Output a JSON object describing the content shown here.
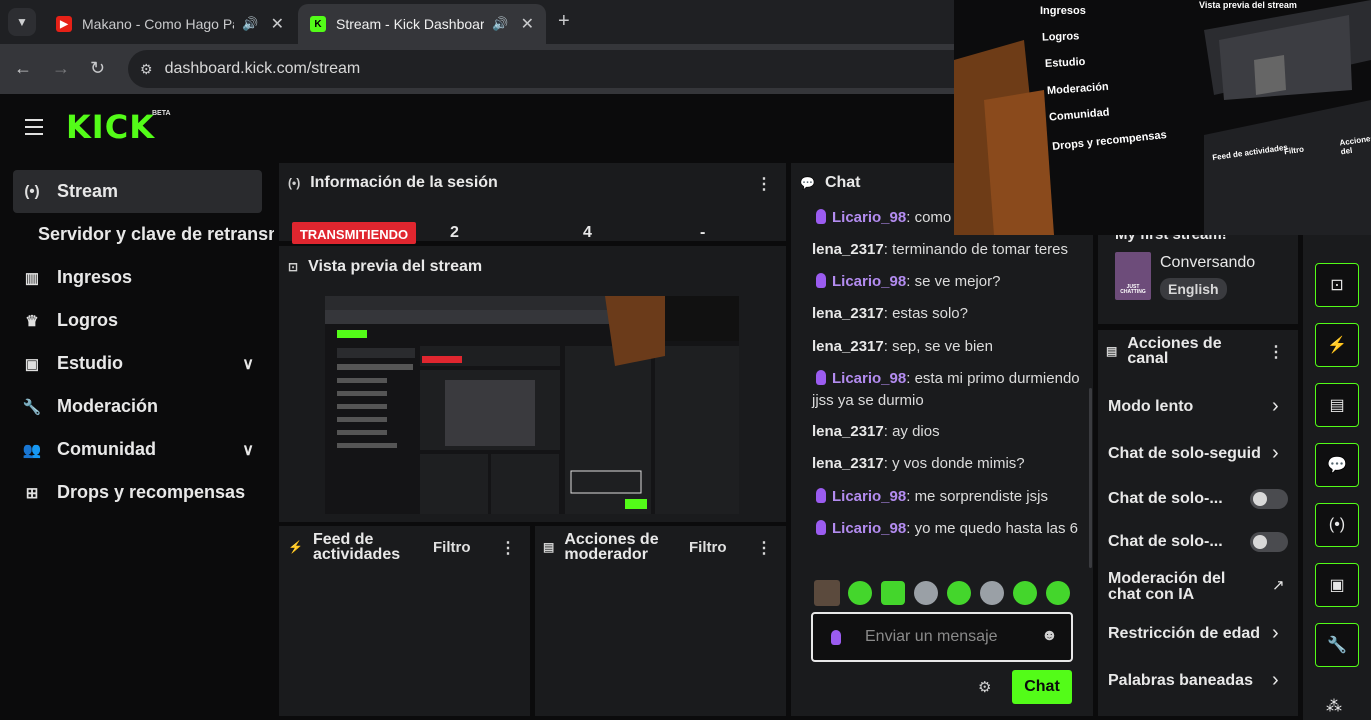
{
  "browser": {
    "tabs": [
      {
        "title": "Makano - Como Hago Para",
        "active": false
      },
      {
        "title": "Stream - Kick Dashboard",
        "active": true
      }
    ],
    "url": "dashboard.kick.com/stream"
  },
  "brand": {
    "logo": "KICK",
    "beta": "BETA",
    "accent": "#53fc18"
  },
  "sidebar": {
    "items": [
      {
        "label": "Stream",
        "icon": "broadcast-icon"
      },
      {
        "label": "Servidor y clave de retransmisión"
      },
      {
        "label": "Ingresos",
        "icon": "chart-icon"
      },
      {
        "label": "Logros",
        "icon": "trophy-icon"
      },
      {
        "label": "Estudio",
        "icon": "studio-icon"
      },
      {
        "label": "Moderación",
        "icon": "wrench-icon"
      },
      {
        "label": "Comunidad",
        "icon": "users-icon"
      },
      {
        "label": "Drops y recompensas",
        "icon": "gift-icon"
      }
    ]
  },
  "session": {
    "title": "Información de la sesión",
    "live_badge": "TRANSMITIENDO",
    "stats": [
      "2",
      "4",
      "-"
    ]
  },
  "preview": {
    "title": "Vista previa del stream"
  },
  "activity": {
    "title_line1": "Feed de",
    "title_line2": "actividades",
    "filter": "Filtro"
  },
  "modactions": {
    "title_line1": "Acciones de",
    "title_line2": "moderador",
    "filter": "Filtro"
  },
  "chat": {
    "title": "Chat",
    "messages": [
      {
        "user": "Licario_98",
        "text": "como",
        "mic": true
      },
      {
        "user": "lena_2317",
        "text": "terminando de tomar teres",
        "mic": false
      },
      {
        "user": "Licario_98",
        "text": "se ve mejor?",
        "mic": true
      },
      {
        "user": "lena_2317",
        "text": "estas solo?",
        "mic": false
      },
      {
        "user": "lena_2317",
        "text": "sep, se ve bien",
        "mic": false
      },
      {
        "user": "Licario_98",
        "text": "esta mi primo durmiendo jjss ya se durmio",
        "mic": true
      },
      {
        "user": "lena_2317",
        "text": "ay dios",
        "mic": false
      },
      {
        "user": "lena_2317",
        "text": "y vos donde mimis?",
        "mic": false
      },
      {
        "user": "Licario_98",
        "text": "me sorprendiste jsjs",
        "mic": true
      },
      {
        "user": "Licario_98",
        "text": "yo me quedo hasta las 6",
        "mic": true
      }
    ],
    "placeholder": "Enviar un mensaje",
    "send_label": "Chat"
  },
  "stream_info": {
    "title": "My first stream!",
    "category": "Conversando",
    "language": "English",
    "category_art": "JUST CHATTING"
  },
  "channel_actions": {
    "title_line1": "Acciones de",
    "title_line2": "canal",
    "items": [
      {
        "label": "Modo lento",
        "control": "arrow"
      },
      {
        "label": "Chat de solo-seguid",
        "control": "arrow"
      },
      {
        "label": "Chat de solo-...",
        "control": "toggle"
      },
      {
        "label": "Chat de solo-...",
        "control": "toggle"
      },
      {
        "label": "Moderación del chat con IA",
        "control": "external"
      },
      {
        "label": "Restricción de edad",
        "control": "arrow"
      },
      {
        "label": "Palabras baneadas",
        "control": "arrow"
      }
    ]
  },
  "overlay": {
    "items": [
      "Ingresos",
      "Logros",
      "Estudio",
      "Moderación",
      "Comunidad",
      "Drops y recompensas"
    ],
    "preview_label": "Vista previa del stream",
    "feed": "Feed de actividades",
    "filter": "Filtro",
    "actions": "Acciones del"
  }
}
